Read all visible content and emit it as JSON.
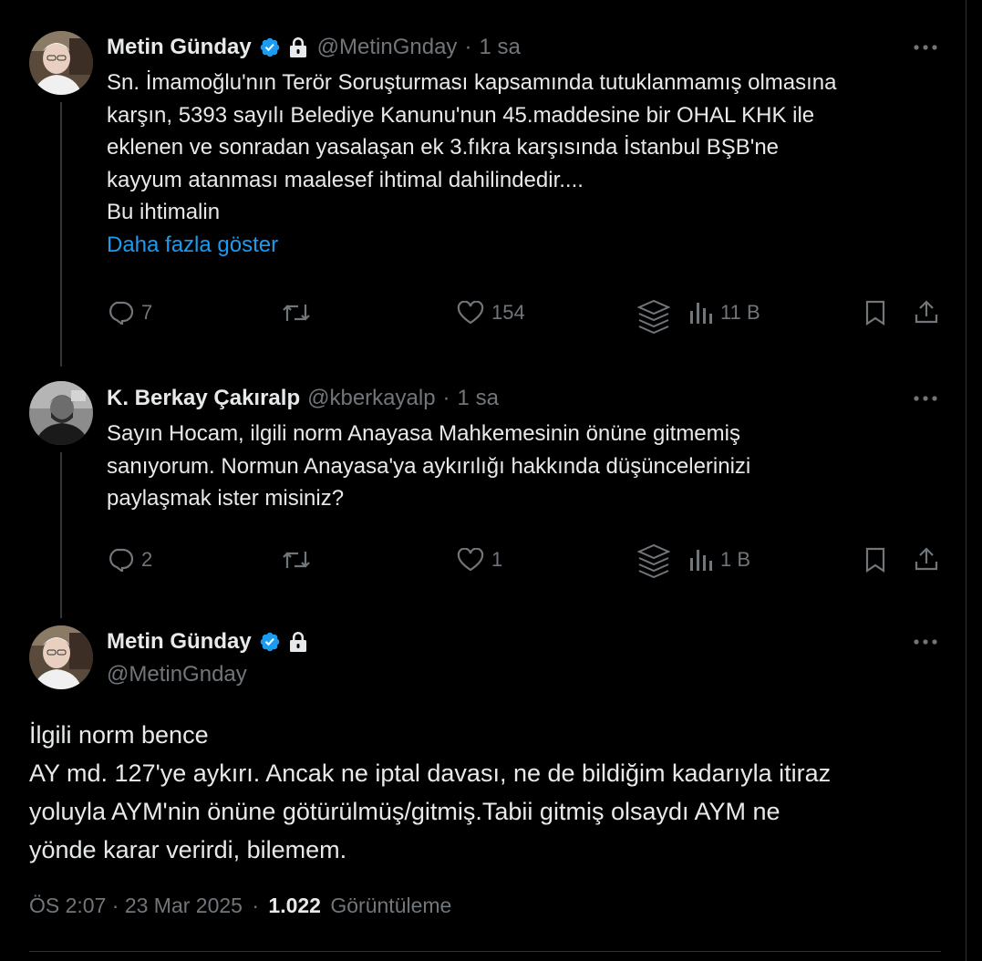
{
  "tweets": [
    {
      "name": "Metin Günday",
      "handle": "@MetinGnday",
      "sep": "·",
      "time": "1 sa",
      "text": "Sn. İmamoğlu'nın Terör Soruşturması kapsamında tutuklanmamış olmasına\nkarşın, 5393 sayılı Belediye Kanunu'nun 45.maddesine bir OHAL KHK ile\neklenen ve sonradan yasalaşan ek 3.fıkra karşısında İstanbul BŞB'ne\nkayyum atanması maalesef ihtimal dahilindedir....\nBu ihtimalin",
      "show_more": "Daha fazla göster",
      "replies": "7",
      "retweets": "",
      "likes": "154",
      "views": "11 B"
    },
    {
      "name": "K. Berkay Çakıralp",
      "handle": "@kberkayalp",
      "sep": "·",
      "time": "1 sa",
      "text": "Sayın Hocam, ilgili norm Anayasa Mahkemesinin önüne gitmemiş\nsanıyorum. Normun Anayasa'ya aykırılığı hakkında düşüncelerinizi\npaylaşmak ister misiniz?",
      "replies": "2",
      "retweets": "",
      "likes": "1",
      "views": "1 B"
    }
  ],
  "main": {
    "name": "Metin Günday",
    "handle": "@MetinGnday",
    "text": "İlgili norm bence\nAY md. 127'ye aykırı. Ancak ne iptal davası, ne de bildiğim kadarıyla itiraz\nyoluyla AYM'nin önüne götürülmüş/gitmiş.Tabii gitmiş olsaydı AYM ne\nyönde karar verirdi, bilemem.",
    "time": "ÖS 2:07 · 23 Mar 2025",
    "sep": "·",
    "views_count": "1.022",
    "views_label": "Görüntüleme"
  },
  "icons": {
    "verified": "verified-badge-icon",
    "lock": "lock-icon",
    "more": "more-icon",
    "reply": "reply-icon",
    "retweet": "retweet-icon",
    "like": "like-icon",
    "grok": "grok-icon",
    "views": "views-icon",
    "bookmark": "bookmark-icon",
    "share": "share-icon"
  },
  "colors": {
    "accent": "#1d9bf0",
    "muted": "#71767b",
    "text": "#e7e9ea",
    "bg": "#000000"
  }
}
